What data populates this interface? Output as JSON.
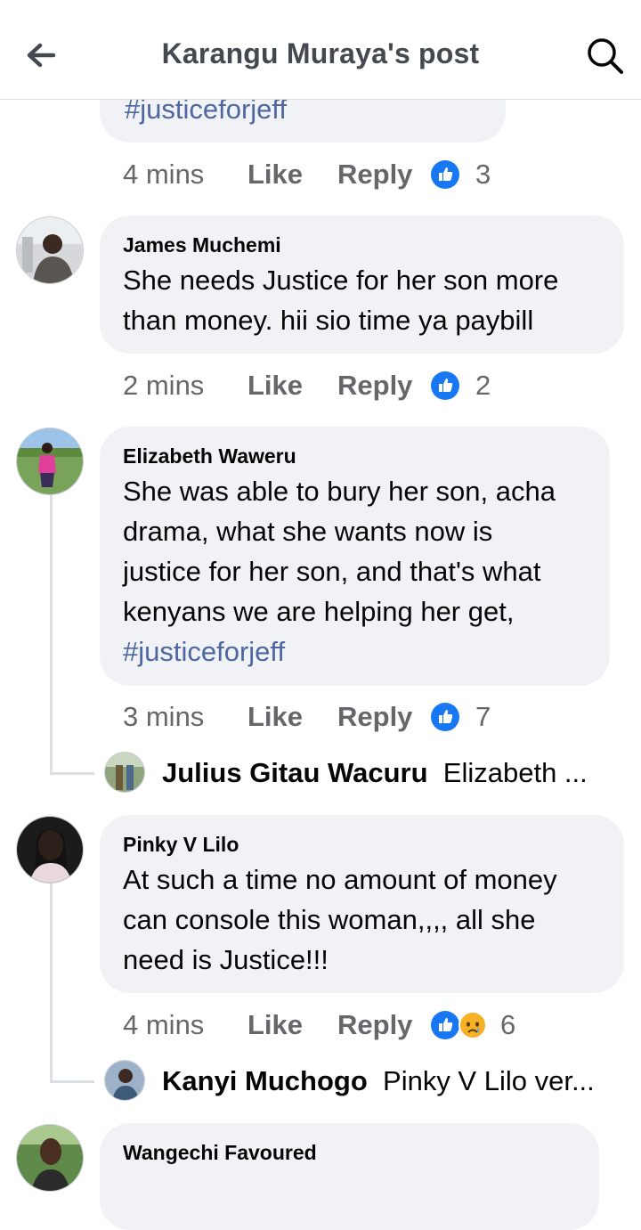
{
  "header": {
    "title": "Karangu Muraya's post"
  },
  "top_fragment": {
    "hashtag": "#justiceforjeff",
    "time": "4 mins",
    "like": "Like",
    "reply": "Reply",
    "count": "3"
  },
  "comments": [
    {
      "author": "James Muchemi",
      "lines": [
        "She needs Justice for her son more",
        "than money. hii sio time ya paybill"
      ],
      "time": "2 mins",
      "like": "Like",
      "reply": "Reply",
      "count": "2"
    },
    {
      "author": "Elizabeth Waweru",
      "lines": [
        "She was able to bury her son, acha",
        "drama, what she wants now is",
        "justice for her son, and that's what",
        "kenyans we are helping her get,"
      ],
      "hashtag": "#justiceforjeff",
      "time": "3 mins",
      "like": "Like",
      "reply": "Reply",
      "count": "7",
      "reply_preview": {
        "name": "Julius Gitau Wacuru",
        "text": "Elizabeth ..."
      }
    },
    {
      "author": "Pinky V Lilo",
      "lines": [
        "At such a time no amount of money",
        "can console this woman,,,, all she",
        "need is Justice!!!"
      ],
      "time": "4 mins",
      "like": "Like",
      "reply": "Reply",
      "count": "6",
      "reply_preview": {
        "name": "Kanyi Muchogo",
        "text": "Pinky V Lilo ver..."
      }
    },
    {
      "author": "Wangechi Favoured"
    }
  ],
  "colors": {
    "like_blue": "#1877f2",
    "bubble": "#f0f2f5",
    "hashtag": "#4e67a0"
  }
}
